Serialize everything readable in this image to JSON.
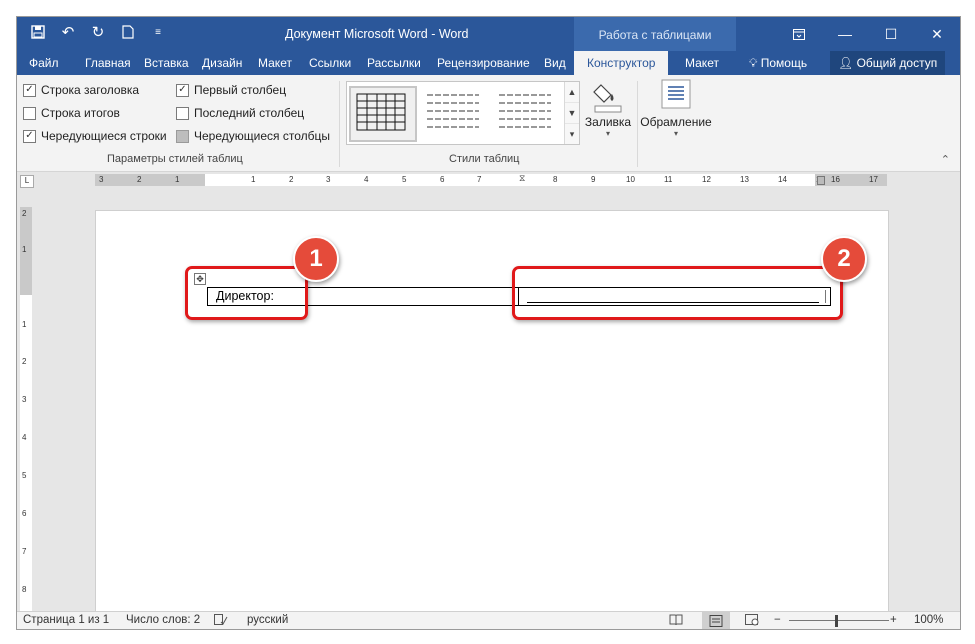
{
  "window": {
    "title": "Документ Microsoft Word - Word",
    "context_tab_group": "Работа с таблицами"
  },
  "quick_access": {
    "icons": [
      "save-icon",
      "undo-icon",
      "redo-icon",
      "new-document-icon",
      "customize-qat-icon"
    ]
  },
  "tabs": [
    {
      "label": "Файл",
      "active": false
    },
    {
      "label": "Главная",
      "active": false
    },
    {
      "label": "Вставка",
      "active": false
    },
    {
      "label": "Дизайн",
      "active": false
    },
    {
      "label": "Макет",
      "active": false
    },
    {
      "label": "Ссылки",
      "active": false
    },
    {
      "label": "Рассылки",
      "active": false
    },
    {
      "label": "Рецензирование",
      "active": false
    },
    {
      "label": "Вид",
      "active": false
    },
    {
      "label": "Конструктор",
      "active": true
    },
    {
      "label": "Макет",
      "active": false
    }
  ],
  "tell_me": "Помощь",
  "share": "Общий доступ",
  "ribbon": {
    "style_options": {
      "label": "Параметры стилей таблиц",
      "items": [
        {
          "label": "Строка заголовка",
          "checked": true
        },
        {
          "label": "Строка итогов",
          "checked": false
        },
        {
          "label": "Чередующиеся строки",
          "checked": true
        },
        {
          "label": "Первый столбец",
          "checked": true
        },
        {
          "label": "Последний столбец",
          "checked": false
        },
        {
          "label": "Чередующиеся столбцы",
          "checked": false
        }
      ]
    },
    "table_styles": {
      "label": "Стили таблиц",
      "shading": "Заливка"
    },
    "borders": {
      "label": "Обрамление"
    }
  },
  "ruler": {
    "horizontal_ticks": [
      "3",
      "2",
      "1",
      "1",
      "2",
      "3",
      "4",
      "5",
      "6",
      "7",
      "8",
      "9",
      "10",
      "11",
      "12",
      "13",
      "14",
      "15",
      "16",
      "17"
    ],
    "vertical_ticks": [
      "2",
      "1",
      "1",
      "2",
      "3",
      "4",
      "5",
      "6",
      "7",
      "8"
    ]
  },
  "document": {
    "cell_text": "Директор:"
  },
  "annotations": [
    {
      "number": "1"
    },
    {
      "number": "2"
    }
  ],
  "statusbar": {
    "page": "Страница 1 из 1",
    "words": "Число слов: 2",
    "language": "русский",
    "zoom": "100%"
  },
  "colors": {
    "word_blue": "#2b579a",
    "highlight_red": "#e0191a",
    "badge_red": "#e54b3a"
  }
}
